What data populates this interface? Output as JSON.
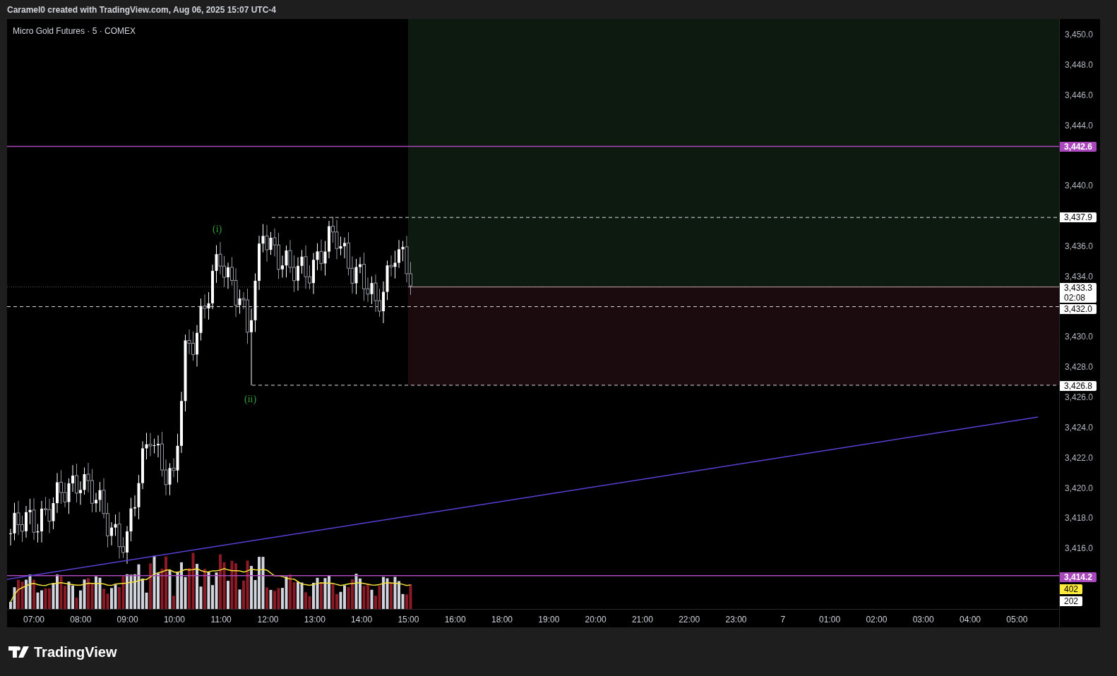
{
  "header": {
    "text": "Caramel0 created with TradingView.com, Aug 06, 2025 15:07 UTC-4"
  },
  "chart": {
    "symbol": "Micro Gold Futures · 5 · COMEX",
    "annotations": [
      {
        "text": "(i)"
      },
      {
        "text": "(ii)"
      }
    ],
    "price_axis": {
      "ticks": [
        "3,450.0",
        "3,448.0",
        "3,446.0",
        "3,444.0",
        "3,440.0",
        "3,436.0",
        "3,434.0",
        "3,430.0",
        "3,428.0",
        "3,426.0",
        "3,424.0",
        "3,422.0",
        "3,420.0",
        "3,418.0",
        "3,416.0"
      ]
    },
    "price_labels": [
      {
        "text": "3,442.6",
        "color": "#ab47bc"
      },
      {
        "text": "3,437.9",
        "color": "#ffffff"
      },
      {
        "text": "3,433.3",
        "countdown": "02:08",
        "color": "#ffffff"
      },
      {
        "text": "3,432.0",
        "color": "#ffffff"
      },
      {
        "text": "3,426.8",
        "color": "#ffffff"
      },
      {
        "text": "3,414.2",
        "color": "#ab47bc"
      },
      {
        "text": "402",
        "color": "#ffeb3b"
      },
      {
        "text": "202",
        "color": "#ffffff"
      }
    ],
    "time_axis": {
      "ticks": [
        "07:00",
        "08:00",
        "09:00",
        "10:00",
        "11:00",
        "12:00",
        "13:00",
        "14:00",
        "15:00",
        "16:00",
        "18:00",
        "19:00",
        "20:00",
        "21:00",
        "22:00",
        "23:00",
        "7",
        "01:00",
        "02:00",
        "03:00",
        "04:00",
        "05:00"
      ]
    }
  },
  "footer": {
    "brand": "TradingView"
  }
}
